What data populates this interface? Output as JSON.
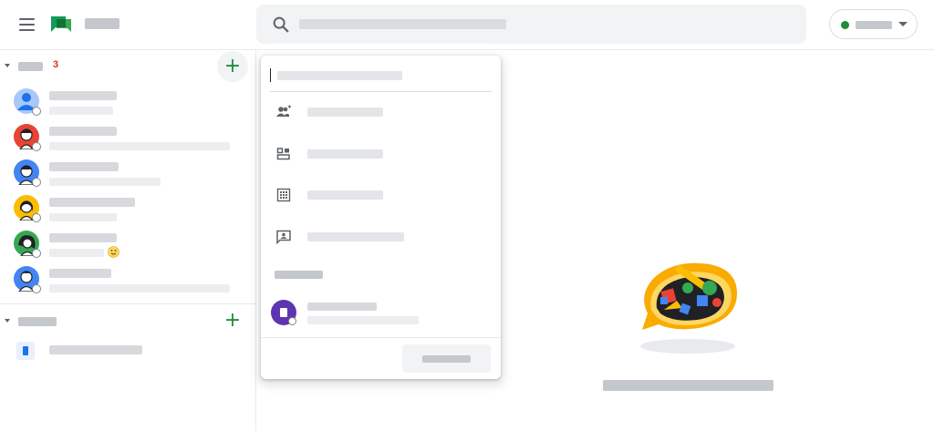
{
  "header": {
    "menu_icon": "hamburger-menu-icon",
    "logo_icon": "chat-logo-icon",
    "app_name": "",
    "search_placeholder": "",
    "status_label": ""
  },
  "sidebar": {
    "chat_section": {
      "label": "",
      "unread_count": "3"
    },
    "rooms_section": {
      "label": ""
    },
    "dm_count": 6
  },
  "new_chat_popup": {
    "input_placeholder": "",
    "options": [
      {
        "icon": "group-add-icon",
        "label": ""
      },
      {
        "icon": "create-space-icon",
        "label": ""
      },
      {
        "icon": "browse-spaces-icon",
        "label": ""
      },
      {
        "icon": "message-requests-icon",
        "label": ""
      }
    ],
    "suggestion": {
      "icon": "room-icon"
    }
  },
  "colors": {
    "accent_green": "#1e8e3e",
    "badge_red": "#d93025",
    "room_purple": "#5e35b1"
  }
}
